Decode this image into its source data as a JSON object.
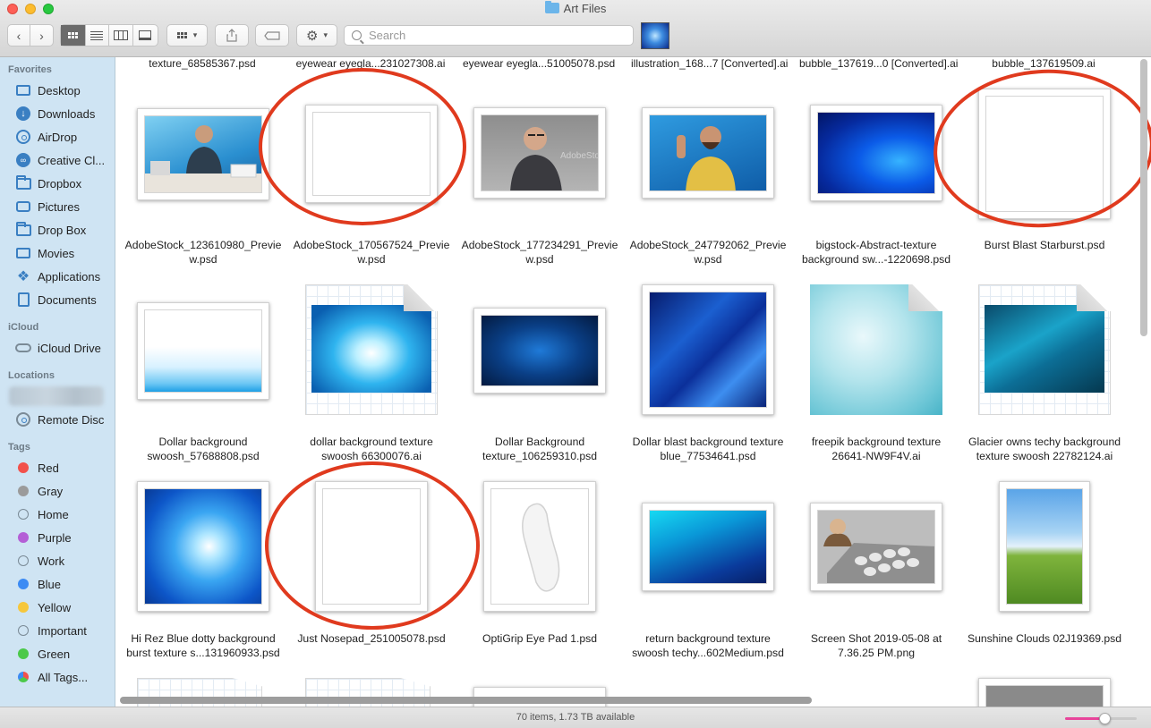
{
  "window": {
    "title": "Art Files"
  },
  "toolbar": {
    "search_placeholder": "Search",
    "icons": [
      "back-arrow",
      "forward-arrow",
      "icon-view",
      "list-view",
      "column-view",
      "gallery-view",
      "group-by",
      "share",
      "edit-tags",
      "action-gear"
    ]
  },
  "sidebar": {
    "favorites_header": "Favorites",
    "favorites": [
      {
        "label": "Desktop",
        "icon": "desktop-icon"
      },
      {
        "label": "Downloads",
        "icon": "downloads-icon"
      },
      {
        "label": "AirDrop",
        "icon": "airdrop-icon"
      },
      {
        "label": "Creative Cl...",
        "icon": "creative-cloud-icon"
      },
      {
        "label": "Dropbox",
        "icon": "folder-icon"
      },
      {
        "label": "Pictures",
        "icon": "pictures-icon"
      },
      {
        "label": "Drop Box",
        "icon": "folder-icon"
      },
      {
        "label": "Movies",
        "icon": "movies-icon"
      },
      {
        "label": "Applications",
        "icon": "applications-icon"
      },
      {
        "label": "Documents",
        "icon": "documents-icon"
      }
    ],
    "icloud_header": "iCloud",
    "icloud": [
      {
        "label": "iCloud Drive",
        "icon": "cloud-icon"
      }
    ],
    "locations_header": "Locations",
    "locations": [
      {
        "label": "Remote Disc",
        "icon": "disc-icon"
      }
    ],
    "tags_header": "Tags",
    "tags": [
      {
        "label": "Red",
        "color": "#f2514b"
      },
      {
        "label": "Gray",
        "color": "#9b9b9b"
      },
      {
        "label": "Home",
        "color": ""
      },
      {
        "label": "Purple",
        "color": "#b45fd6"
      },
      {
        "label": "Work",
        "color": ""
      },
      {
        "label": "Blue",
        "color": "#3c8bf3"
      },
      {
        "label": "Yellow",
        "color": "#f6c73c"
      },
      {
        "label": "Important",
        "color": ""
      },
      {
        "label": "Green",
        "color": "#4cc94a"
      },
      {
        "label": "All Tags...",
        "color": "all"
      }
    ]
  },
  "top_row_names": [
    "texture_68585367.psd",
    "eyewear eyegla...231027308.ai",
    "eyewear eyegla...51005078.psd",
    "illustration_168...7 [Converted].ai",
    "bubble_137619...0 [Converted].ai",
    "bubble_137619509.ai"
  ],
  "files": [
    {
      "name": "AdobeStock_123610980_Preview.psd",
      "line1": "AdobeStock_123610980_Previe",
      "line2": "w.psd"
    },
    {
      "name": "AdobeStock_170567524_Preview.psd",
      "line1": "AdobeStock_170567524_Previe",
      "line2": "w.psd"
    },
    {
      "name": "AdobeStock_177234291_Preview.psd",
      "line1": "AdobeStock_177234291_Previe",
      "line2": "w.psd"
    },
    {
      "name": "AdobeStock_247792062_Preview.psd",
      "line1": "AdobeStock_247792062_Previe",
      "line2": "w.psd"
    },
    {
      "name": "bigstock-Abstract-texture",
      "line1": "bigstock-Abstract-texture",
      "line2": "background sw...-1220698.psd"
    },
    {
      "name": "Burst Blast Starburst.psd",
      "line1": "Burst Blast Starburst.psd",
      "line2": ""
    },
    {
      "name": "Dollar background swoosh_57688808.psd",
      "line1": "Dollar background",
      "line2": "swoosh_57688808.psd"
    },
    {
      "name": "dollar background texture swoosh 66300076.ai",
      "line1": "dollar background texture",
      "line2": "swoosh 66300076.ai"
    },
    {
      "name": "Dollar Background texture_106259310.psd",
      "line1": "Dollar Background",
      "line2": "texture_106259310.psd"
    },
    {
      "name": "Dollar blast background texture blue_77534641.psd",
      "line1": "Dollar blast background texture",
      "line2": "blue_77534641.psd"
    },
    {
      "name": "freepik background texture 26641-NW9F4V.ai",
      "line1": "freepik background texture",
      "line2": "26641-NW9F4V.ai"
    },
    {
      "name": "Glacier owns techy background texture swoosh 22782124.ai",
      "line1": "Glacier owns techy background",
      "line2": "texture swoosh 22782124.ai"
    },
    {
      "name": "Hi Rez Blue dotty background burst texture",
      "line1": "Hi Rez Blue dotty background",
      "line2": "burst texture s...131960933.psd"
    },
    {
      "name": "Just Nosepad_251005078.psd",
      "line1": "Just Nosepad_251005078.psd",
      "line2": ""
    },
    {
      "name": "OptiGrip Eye Pad 1.psd",
      "line1": "OptiGrip Eye Pad 1.psd",
      "line2": ""
    },
    {
      "name": "return background texture swoosh techy",
      "line1": "return background texture",
      "line2": "swoosh techy...602Medium.psd"
    },
    {
      "name": "Screen Shot 2019-05-08 at 7.36.25 PM.png",
      "line1": "Screen Shot 2019-05-08 at",
      "line2": "7.36.25 PM.png"
    },
    {
      "name": "Sunshine Clouds 02J19369.psd",
      "line1": "Sunshine Clouds 02J19369.psd",
      "line2": ""
    }
  ],
  "watermark_text": "AdobeStock",
  "status": {
    "text": "70 items, 1.73 TB available",
    "zoom_level": 0.55
  },
  "annotation_color": "#e03a1e"
}
